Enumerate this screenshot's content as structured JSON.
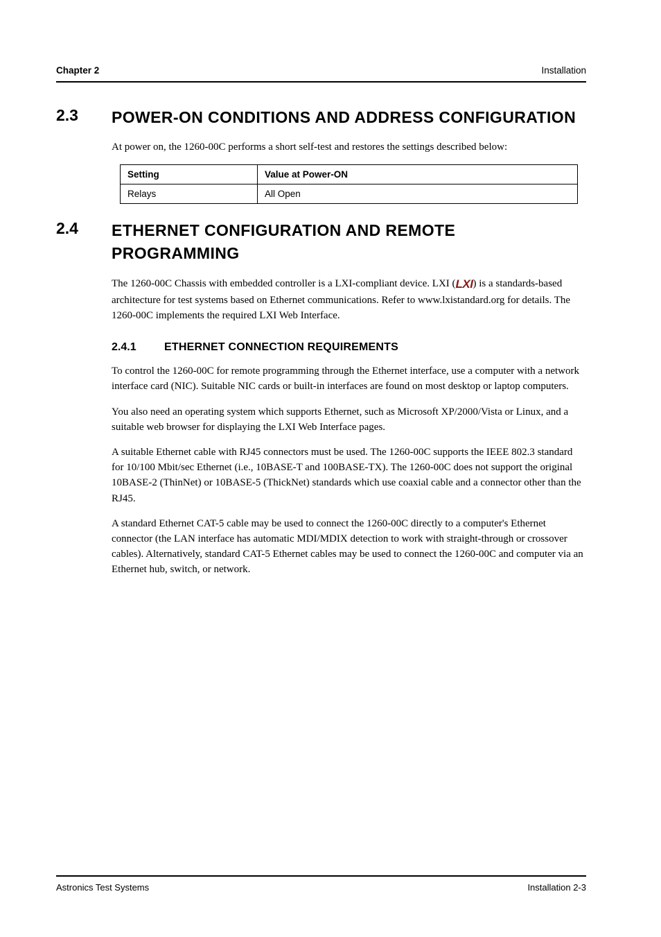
{
  "header": {
    "left": "Chapter 2",
    "right": "Installation"
  },
  "sections": {
    "s23": {
      "num": "2.3",
      "title": "POWER-ON CONDITIONS AND ADDRESS CONFIGURATION",
      "intro": "At power on, the 1260-00C performs a short self-test and restores the settings described below:",
      "table": {
        "h1": "Setting",
        "h2": "Value at Power-ON",
        "r1c1": "Relays",
        "r1c2": "All Open"
      }
    },
    "s24": {
      "num": "2.4",
      "title": "ETHERNET CONFIGURATION AND REMOTE PROGRAMMING",
      "p1_a": "The 1260-00C Chassis with embedded controller is a LXI-compliant device. LXI (",
      "p1_b": ") is a standards-based architecture for test systems based on Ethernet communications. Refer to www.lxistandard.org for details. The 1260-00C implements the required LXI Web Interface.",
      "lxi_label": "LXI"
    },
    "s241": {
      "num": "2.4.1",
      "title": "ETHERNET CONNECTION REQUIREMENTS",
      "p1": "To control the 1260-00C for remote programming through the Ethernet interface, use a computer with a network interface card (NIC). Suitable NIC cards or built-in interfaces are found on most desktop or laptop computers.",
      "p2": "You also need an operating system which supports Ethernet, such as Microsoft XP/2000/Vista or Linux, and a suitable web browser for displaying the LXI Web Interface pages.",
      "p3": "A suitable Ethernet cable with RJ45 connectors must be used. The 1260-00C supports the IEEE 802.3 standard for 10/100 Mbit/sec Ethernet (i.e., 10BASE-T and 100BASE-TX). The 1260-00C does not support the original 10BASE-2 (ThinNet) or 10BASE-5 (ThickNet) standards which use coaxial cable and a connector other than the RJ45.",
      "p4": "A standard Ethernet CAT-5 cable may be used to connect the 1260-00C directly to a computer's Ethernet connector (the LAN interface has automatic MDI/MDIX detection to work with straight-through or crossover cables). Alternatively, standard CAT-5 Ethernet cables may be used to connect the 1260-00C and computer via an Ethernet hub, switch, or network."
    }
  },
  "footer": {
    "left": "Astronics Test Systems",
    "right": "Installation 2-3"
  }
}
